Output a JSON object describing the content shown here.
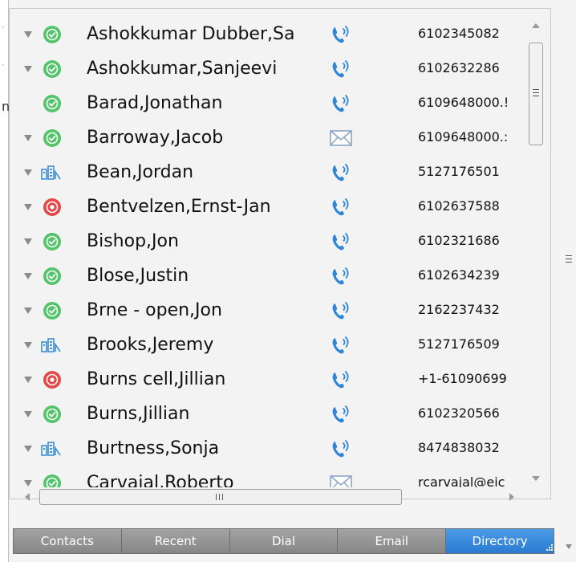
{
  "contacts": [
    {
      "name": "Ashokkumar Dubber,Sa",
      "status": "available",
      "comm": "phone",
      "number": "6102345082",
      "expandable": true
    },
    {
      "name": "Ashokkumar,Sanjeevi",
      "status": "available",
      "comm": "phone",
      "number": "6102632286",
      "expandable": true
    },
    {
      "name": "Barad,Jonathan",
      "status": "available",
      "comm": "phone",
      "number": "6109648000.!",
      "expandable": false
    },
    {
      "name": "Barroway,Jacob",
      "status": "available",
      "comm": "email",
      "number": "6109648000.:",
      "expandable": true
    },
    {
      "name": "Bean,Jordan",
      "status": "directory",
      "comm": "phone",
      "number": "5127176501",
      "expandable": true
    },
    {
      "name": "Bentvelzen,Ernst-Jan",
      "status": "busy",
      "comm": "phone",
      "number": "6102637588",
      "expandable": true
    },
    {
      "name": "Bishop,Jon",
      "status": "available",
      "comm": "phone",
      "number": "6102321686",
      "expandable": true
    },
    {
      "name": "Blose,Justin",
      "status": "available",
      "comm": "phone",
      "number": "6102634239",
      "expandable": true
    },
    {
      "name": "Brne - open,Jon",
      "status": "available",
      "comm": "phone",
      "number": "2162237432",
      "expandable": true
    },
    {
      "name": "Brooks,Jeremy",
      "status": "directory",
      "comm": "phone",
      "number": "5127176509",
      "expandable": true
    },
    {
      "name": "Burns cell,Jillian",
      "status": "busy",
      "comm": "phone",
      "number": "+1-61090699",
      "expandable": true
    },
    {
      "name": "Burns,Jillian",
      "status": "available",
      "comm": "phone",
      "number": "6102320566",
      "expandable": true
    },
    {
      "name": "Burtness,Sonja",
      "status": "directory",
      "comm": "phone",
      "number": "8474838032",
      "expandable": true
    },
    {
      "name": "Carvajal,Roberto",
      "status": "available",
      "comm": "email",
      "number": "rcarvajal@eic",
      "expandable": true
    }
  ],
  "tabs": [
    {
      "label": "Contacts",
      "active": false
    },
    {
      "label": "Recent",
      "active": false
    },
    {
      "label": "Dial",
      "active": false
    },
    {
      "label": "Email",
      "active": false
    },
    {
      "label": "Directory",
      "active": true
    }
  ],
  "colors": {
    "available": "#52c46a",
    "busy": "#e54848",
    "directory": "#3b8fd8",
    "phone": "#2f86d8",
    "email": "#8aa6c4",
    "active_tab": "#3a8ddd"
  },
  "icons": {
    "available": "check-circle-icon",
    "busy": "do-not-disturb-icon",
    "directory": "directory-people-icon",
    "phone": "phone-icon",
    "email": "envelope-icon"
  }
}
